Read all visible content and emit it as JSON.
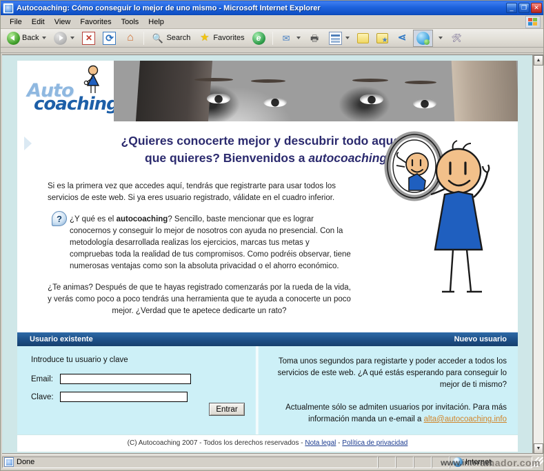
{
  "window": {
    "title": "Autocoaching: Cómo conseguir lo mejor de uno mismo - Microsoft Internet Explorer",
    "minimize_label": "_",
    "maximize_label": "❐",
    "close_label": "✕"
  },
  "menubar": {
    "items": [
      {
        "label": "File"
      },
      {
        "label": "Edit"
      },
      {
        "label": "View"
      },
      {
        "label": "Favorites"
      },
      {
        "label": "Tools"
      },
      {
        "label": "Help"
      }
    ]
  },
  "toolbar": {
    "back_label": "Back",
    "search_label": "Search",
    "favorites_label": "Favorites",
    "icons": [
      "back-icon",
      "forward-icon",
      "stop-icon",
      "refresh-icon",
      "home-icon",
      "search-icon",
      "favorites-star-icon",
      "media-icon",
      "mail-icon",
      "print-icon",
      "edit-icon",
      "folder-icon",
      "messenger-icon",
      "share-icon",
      "msn-icon",
      "tools-icon"
    ]
  },
  "site": {
    "logo": {
      "line1": "Auto",
      "line2": "coaching"
    },
    "hero": {
      "heading_line1": "¿Quieres conocerte mejor y descubrir todo aquello",
      "heading_line2_plain": "que quieres? Bienvenidos a ",
      "heading_line2_em": "autocoaching",
      "heading_line2_end": ".",
      "intro": "Si es la primera vez que accedes aquí, tendrás que registrarte para usar todos los servicios de este web. Si ya eres usuario registrado, válidate en el cuadro inferior.",
      "question_icon_label": "?",
      "what_prefix": "¿Y qué es el ",
      "what_bold": "autocoaching",
      "what_rest": "? Sencillo, baste mencionar que es lograr conocernos y conseguir lo mejor de nosotros con ayuda no presencial. Con la metodología desarrollada realizas los ejercicios, marcas tus metas y compruebas toda la realidad de tus compromisos. Como podréis observar, tiene numerosas ventajas como son la absoluta privacidad o el ahorro económico.",
      "closing": "¿Te animas? Después de que te hayas registrado comenzarás por la rueda de la vida, y verás como poco a poco tendrás una herramienta que te ayuda a conocerte un poco mejor. ¿Verdad que te apetece dedicarte un rato?"
    },
    "bars": {
      "left_label": "Usuario existente",
      "right_label": "Nuevo usuario"
    },
    "login": {
      "lead": "Introduce tu usuario y clave",
      "email_label": "Email:",
      "email_value": "",
      "email_placeholder": "",
      "clave_label": "Clave:",
      "clave_value": "",
      "clave_placeholder": "",
      "submit_label": "Entrar"
    },
    "register": {
      "paragraph1": "Toma unos segundos para registarte y poder acceder a todos los servicios de este web. ¿A qué estás esperando para conseguir lo mejor de ti mismo?",
      "paragraph2_prefix": "Actualmente sólo se admiten usuarios por invitación. Para más información manda un e-email a ",
      "email_link": "alta@autocoaching.info"
    },
    "footer": {
      "copyright": "(C) Autocoaching 2007 - Todos los derechos reservados - ",
      "link_legal": "Nota legal",
      "separator": " - ",
      "link_privacy": "Política de privacidad"
    }
  },
  "statusbar": {
    "status": "Done",
    "zone": "Internet",
    "watermark": "amador.com",
    "watermark_prefix": "www.internet"
  },
  "colors": {
    "titlebar_blue": "#1e63dd",
    "section_bar_blue": "#1d4f86",
    "panel_cyan": "#cdf0f7",
    "heading_navy": "#2b2a6e",
    "logo_blue": "#1d5fa8",
    "logo_light_blue": "#8fb8e0",
    "link_orange": "#d08428",
    "footer_link": "#1a3a8f"
  }
}
